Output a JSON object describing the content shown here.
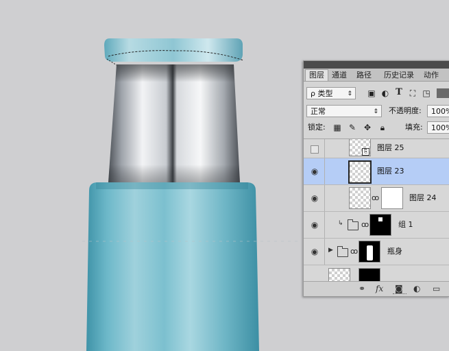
{
  "panel": {
    "tabs": [
      {
        "label": "图层"
      },
      {
        "label": "通道"
      },
      {
        "label": "路径"
      },
      {
        "label": "历史记录"
      },
      {
        "label": "动作"
      }
    ],
    "filter": {
      "label": "ρ 类型",
      "arrow": "⇕"
    },
    "blend": {
      "mode": "正常",
      "arrow": "⇕",
      "opacity_label": "不透明度:",
      "opacity_value": "100%"
    },
    "lock": {
      "label": "锁定:",
      "fill_label": "填充:",
      "fill_value": "100%"
    },
    "layers": [
      {
        "name": "图层 25",
        "visible": false
      },
      {
        "name": "图层 23",
        "visible": true,
        "selected": true
      },
      {
        "name": "图层 24",
        "visible": true
      },
      {
        "name": "组 1",
        "visible": true
      },
      {
        "name": "瓶身",
        "visible": true
      }
    ]
  },
  "colors": {
    "canvas_bg": "#cfcfd1",
    "bottle_teal": "#6fb8c8",
    "selected_layer": "#b5cdf6"
  },
  "icons": [
    "search-icon",
    "image-filter-icon",
    "adjust-filter-icon",
    "text-filter-icon",
    "shape-filter-icon",
    "smart-filter-icon",
    "eye-icon",
    "link-icon",
    "fx-icon",
    "mask-icon",
    "adjustment-icon",
    "folder-icon"
  ]
}
